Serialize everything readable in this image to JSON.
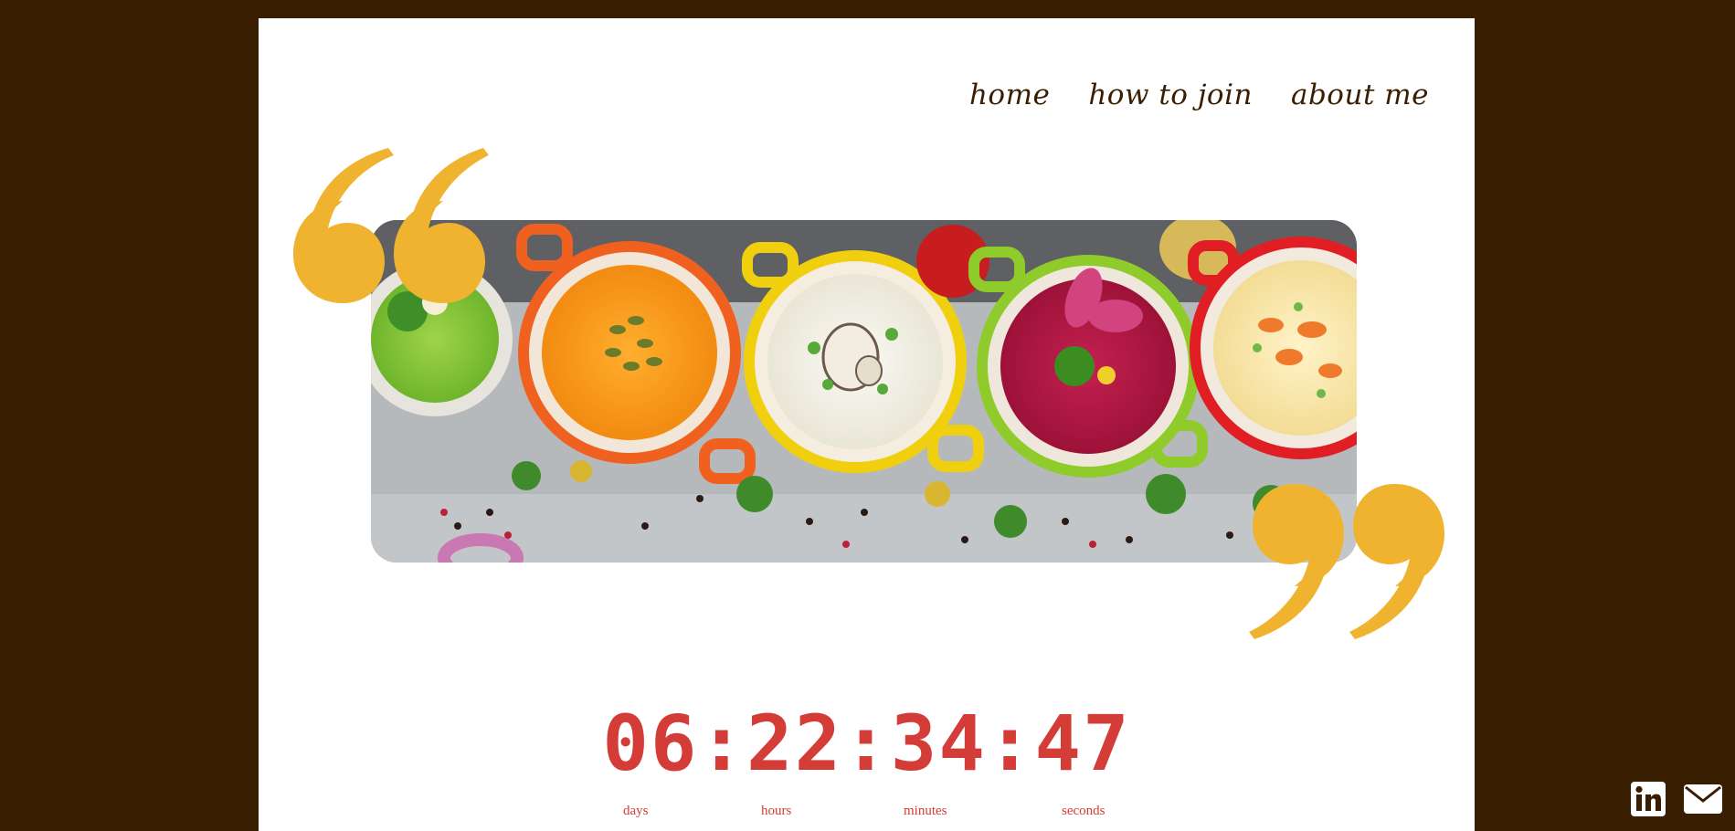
{
  "nav": {
    "items": [
      {
        "label": "home"
      },
      {
        "label": "how to join"
      },
      {
        "label": "about me"
      }
    ]
  },
  "hero": {
    "image_icon": "soup-bowls-photo",
    "quote_open_icon": "open-quote-icon",
    "quote_close_icon": "close-quote-icon"
  },
  "countdown": {
    "value": "06:22:34:47",
    "labels": {
      "days": "days",
      "hours": "hours",
      "minutes": "minutes",
      "seconds": "seconds"
    }
  },
  "social": {
    "linkedin_icon": "linkedin-icon",
    "email_icon": "email-icon"
  },
  "colors": {
    "background": "#3a1e02",
    "accent_quote": "#f0b32f",
    "countdown": "#d43c37",
    "nav_text": "#3a1e02"
  }
}
